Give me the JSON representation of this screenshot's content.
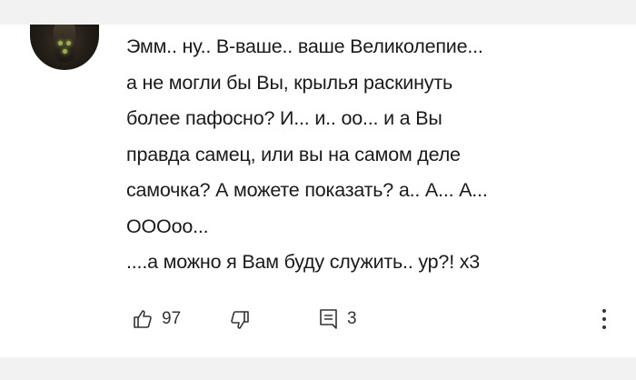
{
  "comment": {
    "lines": [
      "Эмм.. ну.. В-ваше.. ваше Великолепие...",
      "а не могли бы Вы, крылья раскинуть",
      "более пафосно? И... и.. оо... и а Вы",
      "правда самец, или вы на самом деле",
      "самочка? А можете показать? а.. А... А...",
      "ОООоо...",
      "....а можно я Вам буду служить.. ур?! х3"
    ]
  },
  "actions": {
    "like_count": "97",
    "reply_count": "3"
  },
  "icons": {
    "like": "thumbs-up-icon",
    "dislike": "thumbs-down-icon",
    "reply": "reply-icon",
    "more": "more-vertical-icon"
  },
  "colors": {
    "background": "#f2f2f2",
    "card": "#ffffff",
    "text": "#1a1a1a"
  }
}
